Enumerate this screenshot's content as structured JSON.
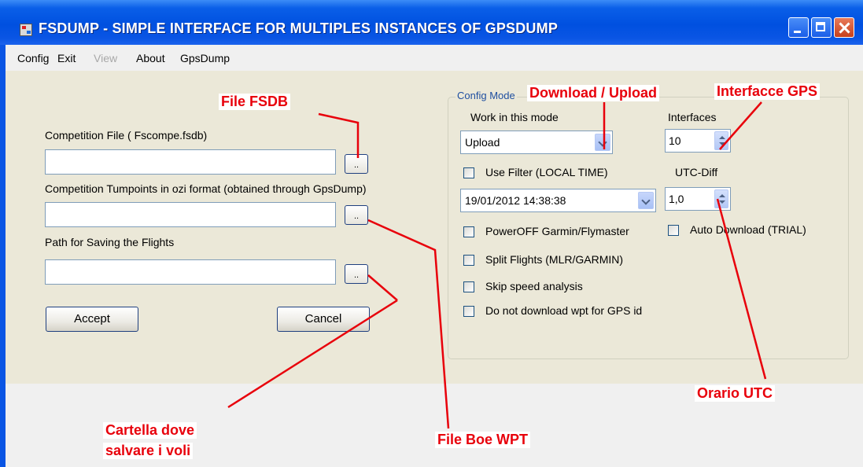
{
  "window": {
    "title": "FSDUMP - SIMPLE INTERFACE FOR  MULTIPLES INSTANCES OF GPSDUMP"
  },
  "menu": [
    {
      "label": "Config",
      "enabled": true
    },
    {
      "label": "Exit",
      "enabled": true
    },
    {
      "label": "View",
      "enabled": false
    },
    {
      "label": "About",
      "enabled": true
    },
    {
      "label": "GpsDump",
      "enabled": true
    }
  ],
  "left": {
    "competition_file_label": "Competition File ( Fscompe.fsdb)",
    "competition_file_value": "",
    "turnpoints_label": "Competition Tumpoints in ozi format (obtained through GpsDump)",
    "turnpoints_value": "",
    "path_label": "Path for Saving the Flights",
    "path_value": "",
    "browse_label": "..",
    "accept_label": "Accept",
    "cancel_label": "Cancel"
  },
  "config": {
    "group_title": "Config Mode",
    "work_mode_label": "Work in this mode",
    "work_mode_value": "Upload",
    "interfaces_label": "Interfaces",
    "interfaces_value": "10",
    "use_filter_label": "Use Filter (LOCAL TIME)",
    "utc_diff_label": "UTC-Diff",
    "filter_datetime": "19/01/2012 14:38:38",
    "utc_diff_value": "1,0",
    "poweroff_label": "PowerOFF Garmin/Flymaster",
    "auto_download_label": "Auto Download (TRIAL)",
    "split_label": "Split  Flights (MLR/GARMIN)",
    "skip_speed_label": "Skip speed analysis",
    "no_wpt_label": "Do not download wpt for GPS id"
  },
  "annotations": {
    "file_fsdb": "File FSDB",
    "download_upload": "Download / Upload",
    "interfacce_gps": "Interfacce GPS",
    "orario_utc": "Orario UTC",
    "file_boe_wpt": "File Boe WPT",
    "cartella_line1": "Cartella dove",
    "cartella_line2": "salvare i voli"
  },
  "colors": {
    "annotation": "#e8000b",
    "titlebar": "#0a55e4",
    "client": "#ebe8d8"
  }
}
